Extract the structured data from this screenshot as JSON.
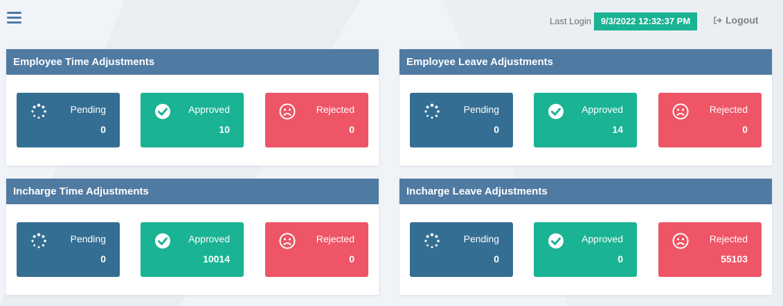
{
  "header": {
    "last_login_label": "Last Login",
    "last_login_value": "9/3/2022 12:32:37 PM",
    "logout_label": "Logout"
  },
  "panels": [
    {
      "title": "Employee Time Adjustments",
      "pending": {
        "label": "Pending",
        "count": "0"
      },
      "approved": {
        "label": "Approved",
        "count": "10"
      },
      "rejected": {
        "label": "Rejected",
        "count": "0"
      }
    },
    {
      "title": "Employee Leave Adjustments",
      "pending": {
        "label": "Pending",
        "count": "0"
      },
      "approved": {
        "label": "Approved",
        "count": "14"
      },
      "rejected": {
        "label": "Rejected",
        "count": "0"
      }
    },
    {
      "title": "Incharge Time Adjustments",
      "pending": {
        "label": "Pending",
        "count": "0"
      },
      "approved": {
        "label": "Approved",
        "count": "10014"
      },
      "rejected": {
        "label": "Rejected",
        "count": "0"
      }
    },
    {
      "title": "Incharge Leave Adjustments",
      "pending": {
        "label": "Pending",
        "count": "0"
      },
      "approved": {
        "label": "Approved",
        "count": "0"
      },
      "rejected": {
        "label": "Rejected",
        "count": "55103"
      }
    }
  ],
  "colors": {
    "header_bar": "#4f7aa2",
    "pending": "#356e93",
    "approved": "#1ab394",
    "rejected": "#ee5567"
  },
  "icons": {
    "menu": "hamburger-menu-icon",
    "logout": "sign-out-icon",
    "pending": "spinner-icon",
    "approved": "check-circle-icon",
    "rejected": "frown-face-icon"
  }
}
